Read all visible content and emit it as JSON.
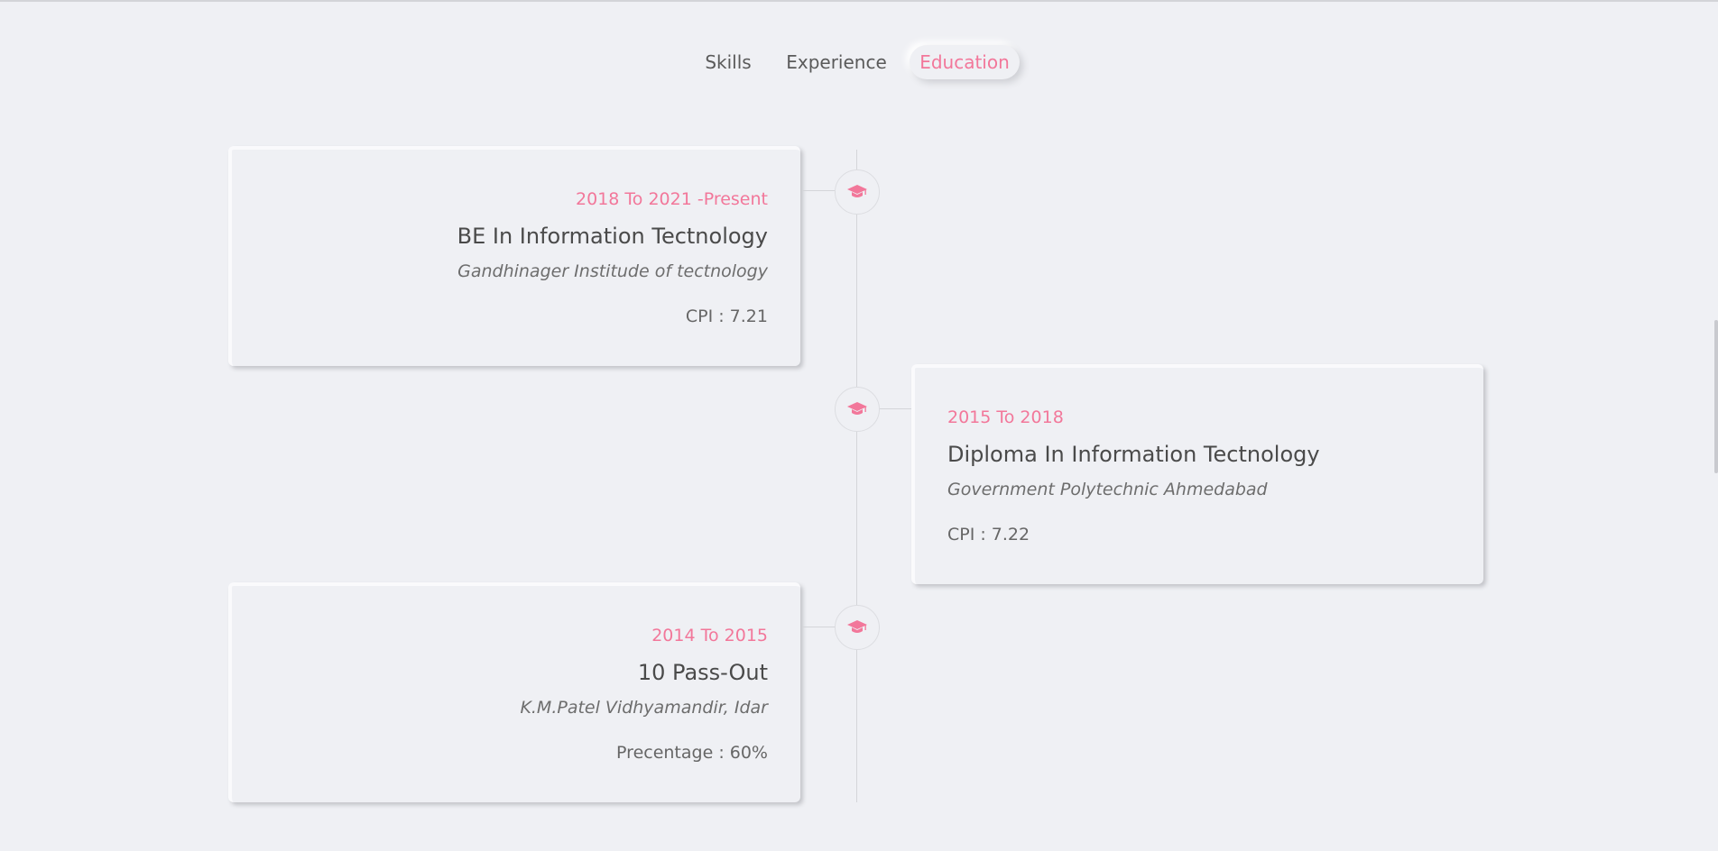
{
  "tabs": [
    {
      "label": "Skills",
      "active": false
    },
    {
      "label": "Experience",
      "active": false
    },
    {
      "label": "Education",
      "active": true
    }
  ],
  "accent_color": "#f2779a",
  "node_icon": "graduation-cap-icon",
  "education": [
    {
      "period": "2018 To 2021 -Present",
      "degree": "BE In Information Tectnology",
      "school": "Gandhinager Institude of tectnology",
      "score": "CPI : 7.21",
      "side": "left"
    },
    {
      "period": "2015 To 2018",
      "degree": "Diploma In Information Tectnology",
      "school": "Government Polytechnic Ahmedabad",
      "score": "CPI : 7.22",
      "side": "right"
    },
    {
      "period": "2014 To 2015",
      "degree": "10 Pass-Out",
      "school": "K.M.Patel Vidhyamandir, Idar",
      "score": "Precentage : 60%",
      "side": "left"
    }
  ]
}
